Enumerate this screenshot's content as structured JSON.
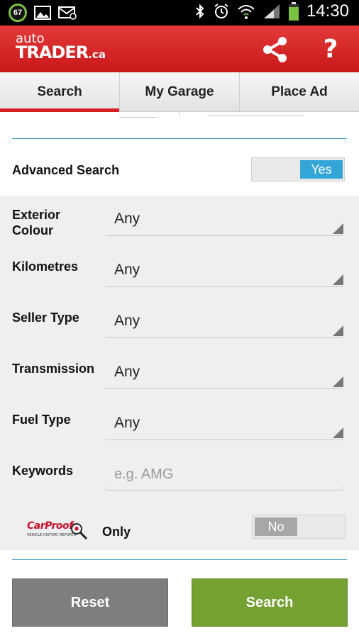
{
  "status_bar": {
    "notification_count": "67",
    "time": "14:30"
  },
  "header": {
    "logo_top": "auto",
    "logo_main": "TRADER",
    "logo_suffix": ".ca",
    "help_label": "?",
    "share_icon": "share-icon",
    "brand_color": "#d71e23"
  },
  "tabs": [
    {
      "label": "Search",
      "active": true
    },
    {
      "label": "My Garage",
      "active": false
    },
    {
      "label": "Place Ad",
      "active": false
    }
  ],
  "advanced_search": {
    "label": "Advanced Search",
    "toggle_value": "Yes",
    "toggle_color": "#33a5d7"
  },
  "filters": [
    {
      "label": "Exterior Colour",
      "value": "Any"
    },
    {
      "label": "Kilometres",
      "value": "Any"
    },
    {
      "label": "Seller Type",
      "value": "Any"
    },
    {
      "label": "Transmission",
      "value": "Any"
    },
    {
      "label": "Fuel Type",
      "value": "Any"
    }
  ],
  "keywords": {
    "label": "Keywords",
    "placeholder": "e.g. AMG",
    "value": ""
  },
  "carproof": {
    "logo_text": "CarProof",
    "logo_sub": "VEHICLE HISTORY REPORTS",
    "only_label": "Only",
    "toggle_value": "No"
  },
  "buttons": {
    "reset_label": "Reset",
    "search_label": "Search",
    "search_color": "#74a132",
    "reset_color": "#7e7e7e"
  }
}
